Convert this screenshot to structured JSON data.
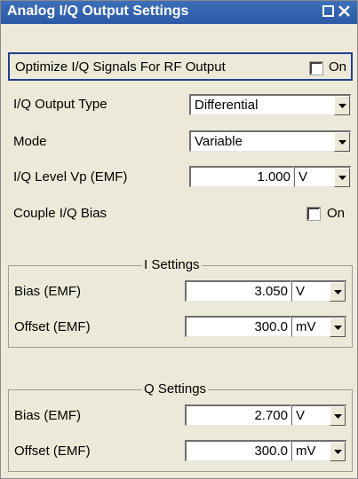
{
  "window": {
    "title": "Analog I/Q Output Settings",
    "restore_icon": "restore-icon",
    "close_icon": "close-icon"
  },
  "optimize": {
    "label": "Optimize I/Q Signals For RF Output",
    "checked": false,
    "check_label": "On"
  },
  "output_type": {
    "label": "I/Q Output Type",
    "value": "Differential"
  },
  "mode": {
    "label": "Mode",
    "value": "Variable"
  },
  "level": {
    "label": "I/Q Level Vp (EMF)",
    "value": "1.000",
    "unit": "V"
  },
  "couple": {
    "label": "Couple I/Q Bias",
    "checked": false,
    "check_label": "On"
  },
  "i_settings": {
    "title": "I Settings",
    "bias": {
      "label": "Bias (EMF)",
      "value": "3.050",
      "unit": "V"
    },
    "offset": {
      "label": "Offset (EMF)",
      "value": "300.0",
      "unit": "mV"
    }
  },
  "q_settings": {
    "title": "Q Settings",
    "bias": {
      "label": "Bias (EMF)",
      "value": "2.700",
      "unit": "V"
    },
    "offset": {
      "label": "Offset (EMF)",
      "value": "300.0",
      "unit": "mV"
    }
  },
  "colors": {
    "titlebar": "#2b59a6",
    "panel": "#ece9d8",
    "focus_border": "#1f3f8f"
  }
}
